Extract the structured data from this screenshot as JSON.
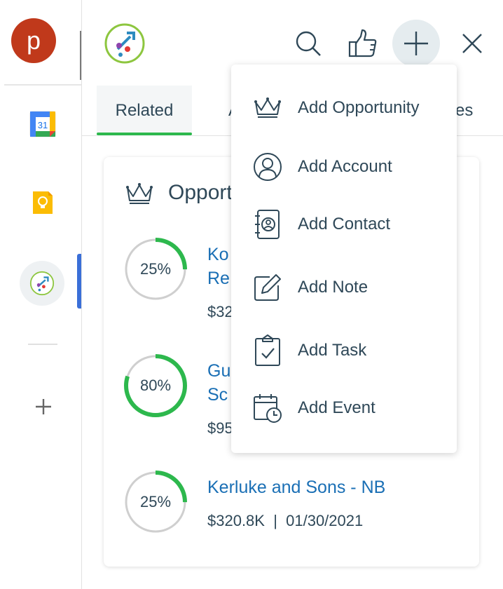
{
  "rail": {
    "avatar_letter": "p",
    "calendar_day": "31"
  },
  "header": {
    "icons": [
      "search-icon",
      "thumbs-up-icon",
      "plus-icon",
      "close-icon"
    ]
  },
  "tabs": {
    "related": "Related",
    "partial_left": "A",
    "partial_right": "es"
  },
  "card": {
    "title": "Opport",
    "opportunities": [
      {
        "percent": "25%",
        "progress": 0.25,
        "name": "Ko\nRe",
        "meta": "$32"
      },
      {
        "percent": "80%",
        "progress": 0.8,
        "name": "Gu\nSc",
        "meta": "$95"
      },
      {
        "percent": "25%",
        "progress": 0.25,
        "name": "Kerluke and Sons - NB",
        "meta": "$320.8K  |  01/30/2021"
      }
    ]
  },
  "menu": {
    "items": [
      {
        "label": "Add Opportunity",
        "icon": "crown-icon"
      },
      {
        "label": "Add Account",
        "icon": "user-circle-icon"
      },
      {
        "label": "Add Contact",
        "icon": "address-book-icon"
      },
      {
        "label": "Add Note",
        "icon": "pencil-note-icon"
      },
      {
        "label": "Add Task",
        "icon": "clipboard-check-icon"
      },
      {
        "label": "Add Event",
        "icon": "calendar-clock-icon"
      }
    ]
  },
  "colors": {
    "accent_green": "#2db84d",
    "link_blue": "#1a6fb5",
    "text_dark": "#2f4858",
    "avatar_red": "#c0391b",
    "rail_active_blue": "#3a6fd8"
  }
}
